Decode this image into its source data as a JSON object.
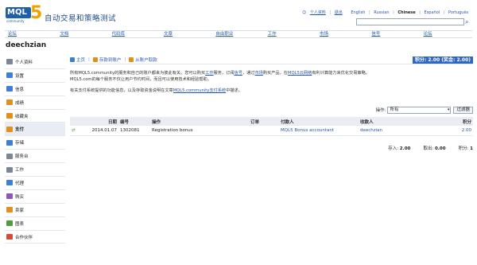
{
  "header": {
    "logo_text": "MQL",
    "logo_number": "5",
    "logo_sub": "community",
    "title": "自动交易和策略测试",
    "top_links": [
      "个人资料",
      "退出",
      "English",
      "Russian",
      "Chinese",
      "Español",
      "Português"
    ],
    "selected_language": "Chinese"
  },
  "nav": {
    "items": [
      "论坛",
      "文档",
      "代码库",
      "文章",
      "自由职业",
      "工作",
      "市场",
      "信号",
      "论坛"
    ]
  },
  "page": {
    "username": "deechzian"
  },
  "sidebar": {
    "items": [
      {
        "label": "个人资料",
        "icon": "person-icon"
      },
      {
        "label": "设置",
        "icon": "settings-icon"
      },
      {
        "label": "信息",
        "icon": "message-icon"
      },
      {
        "label": "成绩",
        "icon": "trophy-icon"
      },
      {
        "label": "收藏夹",
        "icon": "star-icon"
      },
      {
        "label": "支付",
        "icon": "payment-icon"
      },
      {
        "label": "存储",
        "icon": "storage-icon"
      },
      {
        "label": "服务台",
        "icon": "service-desk-icon"
      },
      {
        "label": "工作",
        "icon": "work-icon"
      },
      {
        "label": "代理",
        "icon": "agent-icon"
      },
      {
        "label": "购买",
        "icon": "cart-icon"
      },
      {
        "label": "卖家",
        "icon": "seller-icon"
      },
      {
        "label": "图表",
        "icon": "chart-icon"
      },
      {
        "label": "合作伙伴",
        "icon": "partner-icon"
      }
    ],
    "active_index": 5
  },
  "toolbar": {
    "home": "主页",
    "deposit": "存款到账户",
    "withdraw": "从账户取款",
    "balance": "积分: 2.00 (奖金: 2.00)"
  },
  "description": {
    "line1_a": "所有MQL5.community的服务和自己的账户都来为彼此有关。您可以购买",
    "line1_link1": "工作",
    "line1_b": "服务，订阅",
    "line1_link2": "信号",
    "line1_c": "，通过",
    "line1_link3": "市场",
    "line1_d": "购买产品，在",
    "line1_link4": "MQL5云网络",
    "line1_e": "有利计算能力来优化交易策略。",
    "line2": "MQL5.com的每个服务不仅让用户节约时间，而且可以使用技术和经验帮助。",
    "line3_a": "有关支付系统提供的功能信息，以及存取资金说明在文章",
    "line3_link": "MQL5.community支付系统",
    "line3_b": "中描述。"
  },
  "filter": {
    "label": "操作:",
    "selected": "所有",
    "button": "过滤器"
  },
  "table": {
    "headers": [
      "日期",
      "编号",
      "操作",
      "订单",
      "付款人",
      "收款人",
      "积分"
    ],
    "rows": [
      {
        "date": "2014.01.07",
        "number": "1302081",
        "operation": "Registration bonus",
        "order": "",
        "payer": "MQL5 Bonus accountant",
        "payee": "deechzian",
        "points": "2.00"
      }
    ]
  },
  "totals": {
    "deposit_label": "存入:",
    "deposit_value": "2.00",
    "withdraw_label": "取出:",
    "withdraw_value": "0.00",
    "points_label": "积分:",
    "points_value": "1"
  }
}
